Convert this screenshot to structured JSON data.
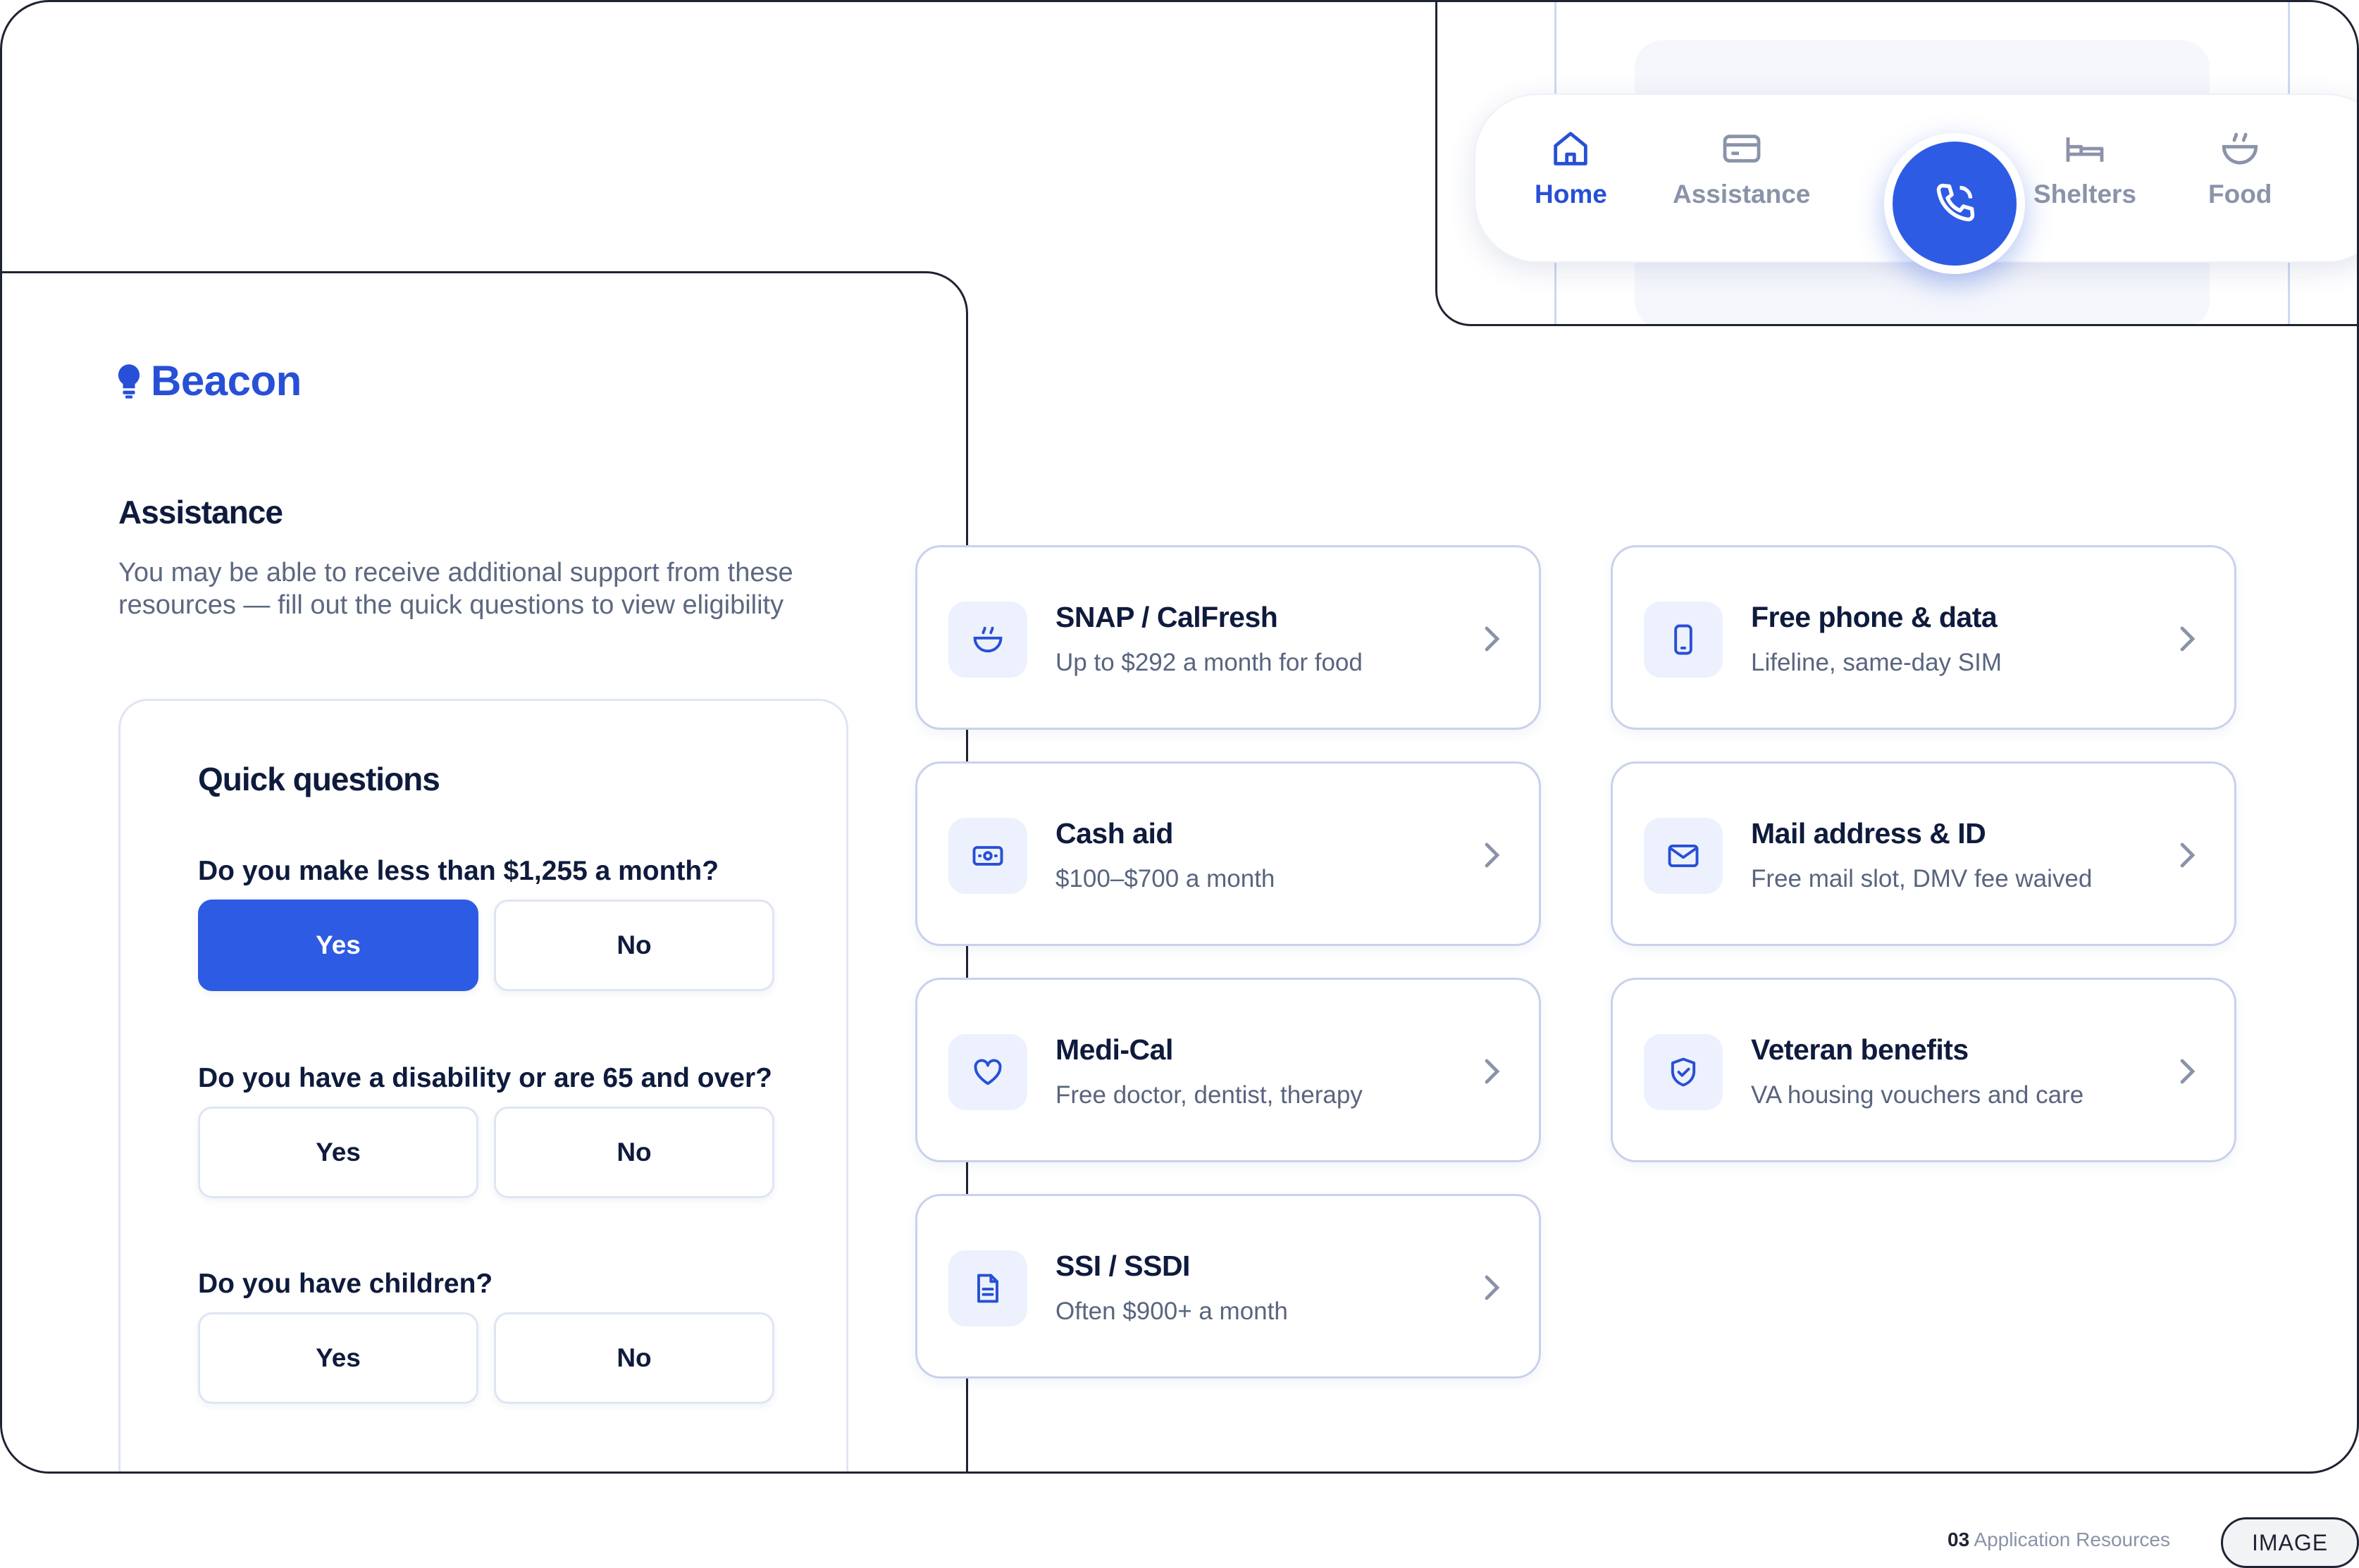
{
  "brand": {
    "name": "Beacon",
    "accent": "#2750d6"
  },
  "section": {
    "title": "Assistance",
    "description": "You may be able to receive additional support from these resources — fill out the quick questions to view eligibility"
  },
  "quick_questions": {
    "title": "Quick questions",
    "items": [
      {
        "question": "Do you make less than $1,255 a month?",
        "yes": "Yes",
        "no": "No",
        "selected": "Yes"
      },
      {
        "question": "Do you have a disability or are 65 and over?",
        "yes": "Yes",
        "no": "No",
        "selected": ""
      },
      {
        "question": "Do you have children?",
        "yes": "Yes",
        "no": "No",
        "selected": ""
      }
    ]
  },
  "resources": [
    {
      "title": "SNAP / CalFresh",
      "subtitle": "Up to $292 a month for food",
      "icon": "bowl-icon"
    },
    {
      "title": "Free phone & data",
      "subtitle": "Lifeline, same-day SIM",
      "icon": "phone-device-icon"
    },
    {
      "title": "Cash aid",
      "subtitle": "$100–$700 a month",
      "icon": "cash-icon"
    },
    {
      "title": "Mail address & ID",
      "subtitle": "Free mail slot, DMV fee waived",
      "icon": "mail-icon"
    },
    {
      "title": "Medi-Cal",
      "subtitle": "Free doctor, dentist, therapy",
      "icon": "heart-icon"
    },
    {
      "title": "Veteran benefits",
      "subtitle": "VA housing vouchers and care",
      "icon": "shield-icon"
    },
    {
      "title": "SSI / SSDI",
      "subtitle": "Often $900+ a month",
      "icon": "document-icon"
    }
  ],
  "nav": {
    "items": [
      {
        "label": "Home",
        "icon": "home-icon",
        "active": true
      },
      {
        "label": "Assistance",
        "icon": "card-icon",
        "active": false
      },
      {
        "label": "Shelters",
        "icon": "bed-icon",
        "active": false
      },
      {
        "label": "Food",
        "icon": "bowl-icon",
        "active": false
      }
    ],
    "fab_icon": "phone-icon"
  },
  "footer": {
    "number": "03",
    "label": "Application Resources",
    "tag": "IMAGE"
  }
}
